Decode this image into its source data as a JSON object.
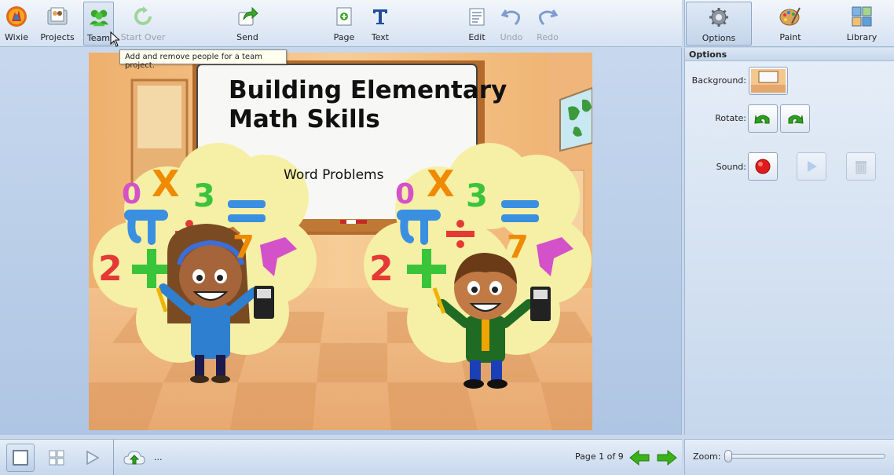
{
  "toolbar": {
    "wixie": "Wixie",
    "projects": "Projects",
    "team": "Team",
    "start_over": "Start Over",
    "send": "Send",
    "page": "Page",
    "text": "Text",
    "edit": "Edit",
    "undo": "Undo",
    "redo": "Redo"
  },
  "right_toolbar": {
    "options": "Options",
    "paint": "Paint",
    "library": "Library"
  },
  "tooltip": "Add and remove people for a team project.",
  "slide": {
    "title_line1": "Building Elementary",
    "title_line2": "Math Skills",
    "subtitle": "Word Problems",
    "symbols": [
      "0",
      "X",
      "3",
      "2",
      "7"
    ]
  },
  "options_panel": {
    "header": "Options",
    "background_label": "Background:",
    "rotate_label": "Rotate:",
    "sound_label": "Sound:"
  },
  "bottom": {
    "ellipsis": "...",
    "page_indicator": "Page 1 of 9",
    "zoom_label": "Zoom:",
    "zoom_value": 0
  },
  "colors": {
    "wall": "#f7c58a",
    "board": "#f4f4f2",
    "cloud": "#f5f0a6",
    "green_arrow": "#3bb318"
  }
}
